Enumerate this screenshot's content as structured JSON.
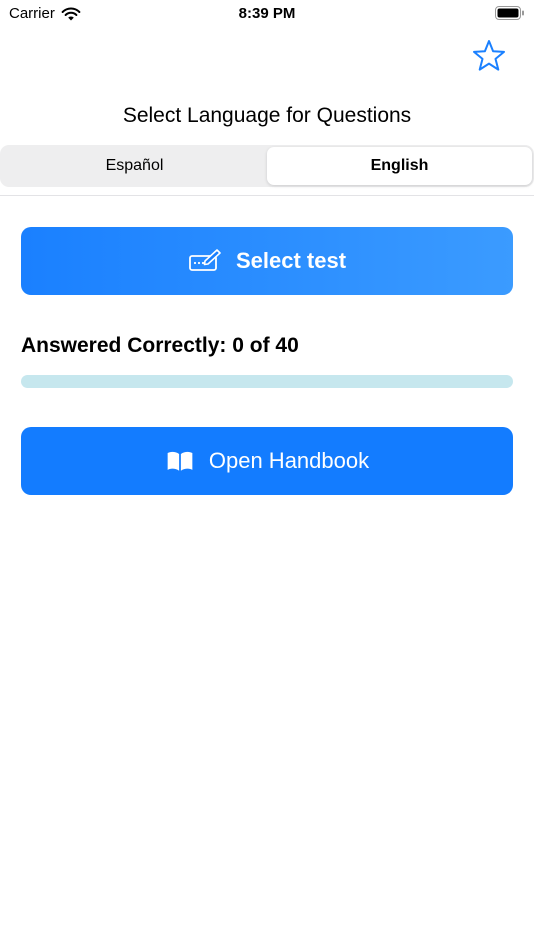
{
  "status_bar": {
    "carrier": "Carrier",
    "time": "8:39 PM",
    "wifi_icon": "wifi-icon",
    "battery_icon": "battery-icon"
  },
  "header": {
    "favorite_icon": "star-icon",
    "title": "Select Language for Questions"
  },
  "language_segment": {
    "options": [
      "Español",
      "English"
    ],
    "selected": "English"
  },
  "select_test_button": {
    "label": "Select test",
    "icon": "keyboard-pencil-icon"
  },
  "progress": {
    "label": "Answered Correctly: 0 of 40",
    "correct": 0,
    "total": 40,
    "fraction": 0.0
  },
  "open_handbook_button": {
    "label": "Open Handbook",
    "icon": "book-icon"
  },
  "colors": {
    "accent": "#1a80ff",
    "progress_track": "#c6e7ee",
    "segment_bg": "#eeeeef"
  }
}
